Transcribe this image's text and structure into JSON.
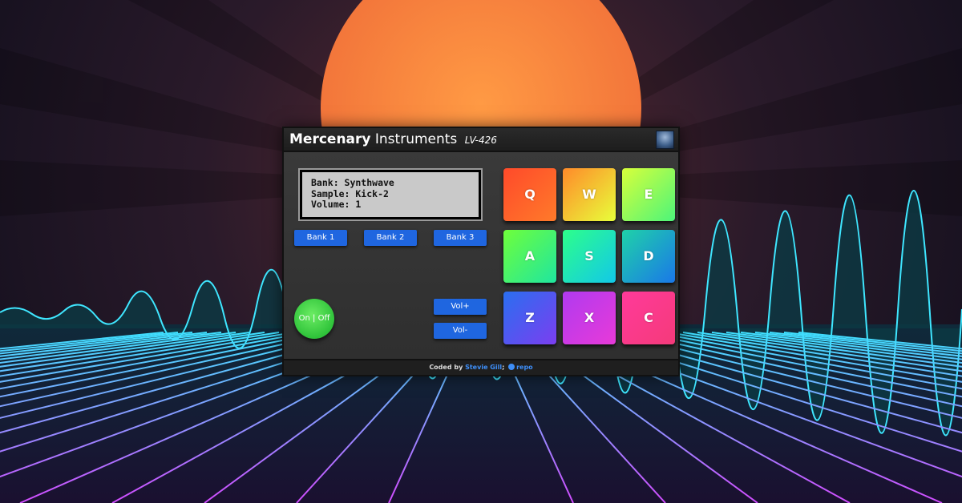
{
  "header": {
    "brand_bold": "Mercenary",
    "brand_regular": "Instruments",
    "model": "LV-426"
  },
  "display": {
    "bank": "Bank: Synthwave",
    "sample": "Sample: Kick-2",
    "volume": "Volume: 1"
  },
  "banks": [
    "Bank 1",
    "Bank 2",
    "Bank 3"
  ],
  "power_label": "On | Off",
  "volume_controls": {
    "up": "Vol+",
    "down": "Vol-"
  },
  "pads": [
    {
      "key": "Q",
      "from": "#ff4a2a",
      "to": "#ff7a2a"
    },
    {
      "key": "W",
      "from": "#ff8a2a",
      "to": "#e8ff3a"
    },
    {
      "key": "E",
      "from": "#d8ff3a",
      "to": "#4cf57a"
    },
    {
      "key": "A",
      "from": "#6fff3a",
      "to": "#1fe6a0"
    },
    {
      "key": "S",
      "from": "#2dff8a",
      "to": "#12c8e8"
    },
    {
      "key": "D",
      "from": "#1fd2a8",
      "to": "#1a78e8"
    },
    {
      "key": "Z",
      "from": "#2a6ff0",
      "to": "#7b3ef0"
    },
    {
      "key": "X",
      "from": "#b03af0",
      "to": "#e83ad8"
    },
    {
      "key": "C",
      "from": "#ff3a9a",
      "to": "#f53a7a"
    }
  ],
  "footer": {
    "prefix": "Coded by",
    "author": "Stevie Gill",
    "separator": ";",
    "repo": "repo"
  }
}
